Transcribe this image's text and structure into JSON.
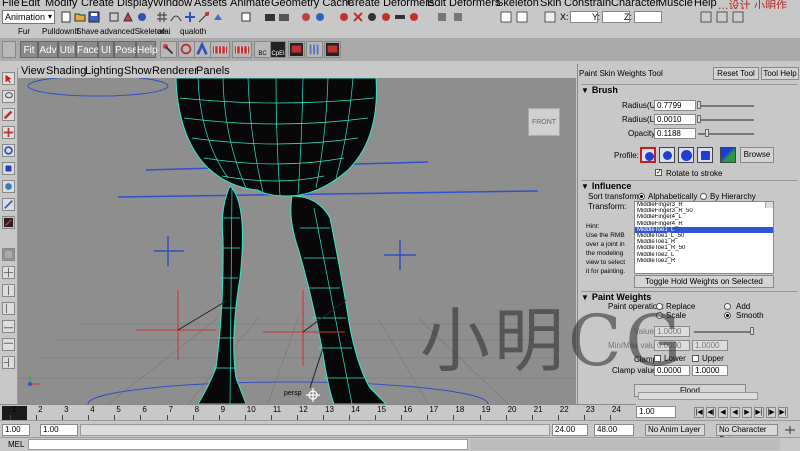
{
  "menubar": {
    "items": [
      "File",
      "Edit",
      "Modify",
      "Create",
      "Display",
      "Window",
      "Assets",
      "Animate",
      "Geometry Cache",
      "Create Deformers",
      "Edit Deformers",
      "Skeleton",
      "Skin",
      "Constrain",
      "Character",
      "Muscle",
      "Help"
    ],
    "watermark_text": "...设计 小明作"
  },
  "toolbar": {
    "mode": "Animation",
    "x_label": "X:",
    "y_label": "Y:",
    "z_label": "Z:"
  },
  "shelf_tabs": [
    "Fur",
    "PulldownIt",
    "Shave",
    "advancedSkeleton",
    "alai",
    "qualoth"
  ],
  "shelf_buttons": [
    "Fit",
    "Adv",
    "Util",
    "Face",
    "UI",
    "Pose",
    "Help"
  ],
  "shelf_labels": {
    "bc": "BC",
    "cp": "CpEl"
  },
  "panel_menu": [
    "View",
    "Shading",
    "Lighting",
    "Show",
    "Renderer",
    "Panels"
  ],
  "viewport": {
    "view_cube": "FRONT",
    "camera_label": "persp",
    "wireframe_color": "#2ee8c8"
  },
  "tool_settings": {
    "title": "Paint Skin Weights Tool",
    "reset_button": "Reset Tool",
    "help_button": "Tool Help",
    "brush": {
      "header": "Brush",
      "radius_u_label": "Radius(U):",
      "radius_u": "0.7799",
      "radius_l_label": "Radius(L):",
      "radius_l": "0.0010",
      "opacity_label": "Opacity:",
      "opacity": "0.1188",
      "profile_label": "Profile:",
      "browse_button": "Browse",
      "rotate_label": "Rotate to stroke"
    },
    "influence": {
      "header": "Influence",
      "sort_label": "Sort transforms:",
      "sort_alpha": "Alphabetically",
      "sort_hierarchy": "By Hierarchy",
      "transform_label": "Transform:",
      "hint_text": [
        "Hint:",
        "Use the RMB",
        "over a joint in",
        "the modeling",
        "view to select",
        "it for painting."
      ],
      "items": [
        "MiddleFinger3_R",
        "MiddleFinger3_R_50",
        "MiddleFinger4_L",
        "MiddleFinger4_R",
        "MiddleToe1_L",
        "MiddleToe1_L_50",
        "MiddleToe1_R",
        "MiddleToe1_R_50",
        "MiddleToe2_L",
        "MiddleToe2_R"
      ],
      "selected_index": 4,
      "toggle_button": "Toggle Hold Weights on Selected"
    },
    "paint_weights": {
      "header": "Paint Weights",
      "operation_label": "Paint operation:",
      "replace": "Replace",
      "add": "Add",
      "scale": "Scale",
      "smooth": "Smooth",
      "value_label": "Value:",
      "value": "1.0000",
      "minmax_label": "Min/Max values:",
      "min": "0.0000",
      "max": "1.0000",
      "clamp_label": "Clamp:",
      "lower": "Lower",
      "upper": "Upper",
      "clamp_values_label": "Clamp values:",
      "clamp_min": "0.0000",
      "clamp_max": "1.0000",
      "flood_button": "Flood"
    }
  },
  "timeline": {
    "ticks": [
      "1",
      "2",
      "3",
      "4",
      "5",
      "6",
      "7",
      "8",
      "9",
      "10",
      "11",
      "12",
      "13",
      "14",
      "15",
      "16",
      "17",
      "18",
      "19",
      "20",
      "21",
      "22",
      "23",
      "24"
    ],
    "current_frame": "1.00"
  },
  "range": {
    "start": "1.00",
    "playback_start": "1.00",
    "playback_end": "24.00",
    "end": "48.00",
    "anim_layer": "No Anim Layer",
    "character_set": "No Character Set"
  },
  "cmdline": {
    "label": "MEL"
  },
  "watermark": "小明CG"
}
